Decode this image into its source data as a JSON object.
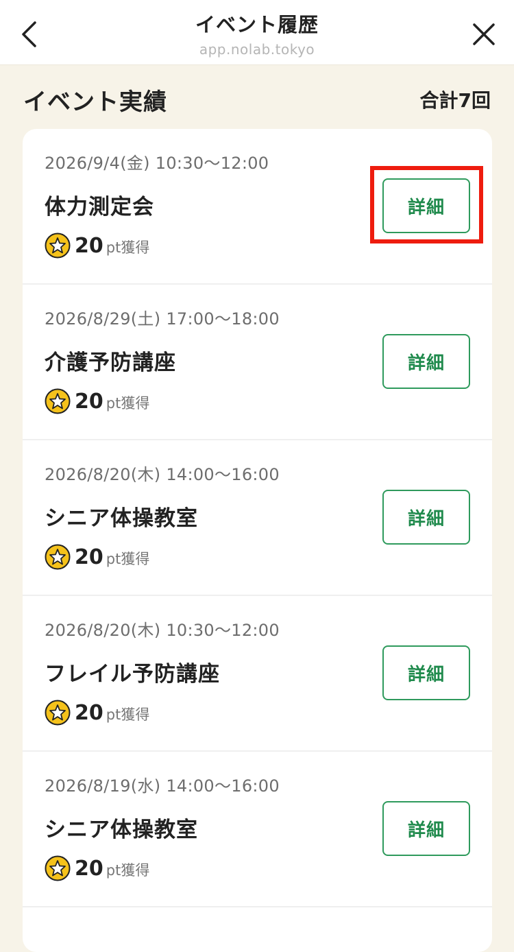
{
  "header": {
    "title": "イベント履歴",
    "url": "app.nolab.tokyo",
    "back_icon": "chevron-left-icon",
    "close_icon": "close-icon"
  },
  "section": {
    "title": "イベント実績",
    "total": "合計7回"
  },
  "items": [
    {
      "date": "2026/9/4(金) 10:30〜12:00",
      "name": "体力測定会",
      "points": "20",
      "unit": "pt獲得",
      "button": "詳細"
    },
    {
      "date": "2026/8/29(土) 17:00〜18:00",
      "name": "介護予防講座",
      "points": "20",
      "unit": "pt獲得",
      "button": "詳細"
    },
    {
      "date": "2026/8/20(木) 14:00〜16:00",
      "name": "シニア体操教室",
      "points": "20",
      "unit": "pt獲得",
      "button": "詳細"
    },
    {
      "date": "2026/8/20(木) 10:30〜12:00",
      "name": "フレイル予防講座",
      "points": "20",
      "unit": "pt獲得",
      "button": "詳細"
    },
    {
      "date": "2026/8/19(水) 14:00〜16:00",
      "name": "シニア体操教室",
      "points": "20",
      "unit": "pt獲得",
      "button": "詳細"
    }
  ],
  "colors": {
    "accent_green": "#1f8a4c",
    "background": "#f7f3e8",
    "star_yellow": "#f5c21b",
    "highlight_red": "#ee1c0e"
  }
}
